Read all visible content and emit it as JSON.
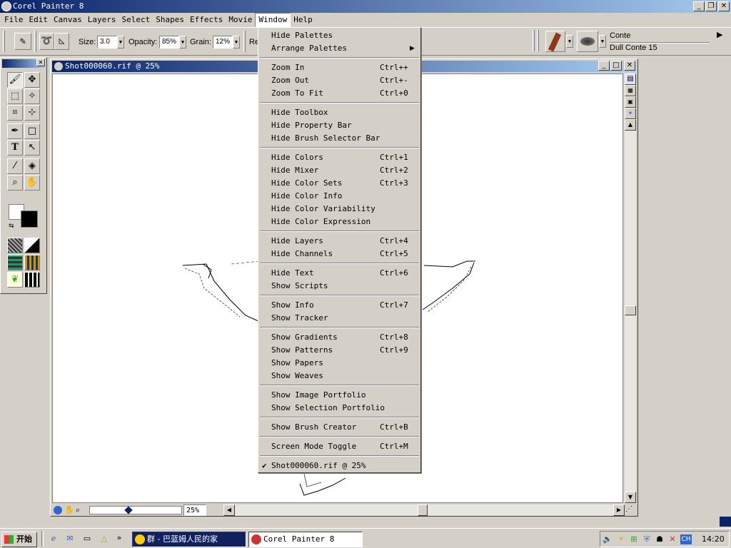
{
  "app": {
    "title": "Corel Painter 8"
  },
  "menubar": [
    {
      "label": "File"
    },
    {
      "label": "Edit"
    },
    {
      "label": "Canvas"
    },
    {
      "label": "Layers"
    },
    {
      "label": "Select"
    },
    {
      "label": "Shapes"
    },
    {
      "label": "Effects"
    },
    {
      "label": "Movie"
    },
    {
      "label": "Window"
    },
    {
      "label": "Help"
    }
  ],
  "propbar": {
    "size_label": "Size:",
    "size_value": "3.0",
    "opacity_label": "Opacity:",
    "opacity_value": "85%",
    "grain_label": "Grain:",
    "grain_value": "12%",
    "extra_label": "Re"
  },
  "brush": {
    "category": "Conte",
    "variant": "Dull Conte 15"
  },
  "document": {
    "title": "Shot000060.rif @ 25%",
    "zoom": "25%"
  },
  "window_menu": {
    "items": [
      {
        "label": "Hide Palettes",
        "shortcut": ""
      },
      {
        "label": "Arrange Palettes",
        "shortcut": "",
        "submenu": true
      },
      {
        "label": "Zoom In",
        "shortcut": "Ctrl++"
      },
      {
        "label": "Zoom Out",
        "shortcut": "Ctrl+-"
      },
      {
        "label": "Zoom To Fit",
        "shortcut": "Ctrl+0"
      },
      {
        "label": "Hide Toolbox",
        "shortcut": ""
      },
      {
        "label": "Hide Property Bar",
        "shortcut": ""
      },
      {
        "label": "Hide Brush Selector Bar",
        "shortcut": ""
      },
      {
        "label": "Hide Colors",
        "shortcut": "Ctrl+1"
      },
      {
        "label": "Hide Mixer",
        "shortcut": "Ctrl+2"
      },
      {
        "label": "Hide Color Sets",
        "shortcut": "Ctrl+3"
      },
      {
        "label": "Hide Color Info",
        "shortcut": ""
      },
      {
        "label": "Hide Color Variability",
        "shortcut": ""
      },
      {
        "label": "Hide Color Expression",
        "shortcut": ""
      },
      {
        "label": "Hide Layers",
        "shortcut": "Ctrl+4"
      },
      {
        "label": "Hide Channels",
        "shortcut": "Ctrl+5"
      },
      {
        "label": "Hide Text",
        "shortcut": "Ctrl+6"
      },
      {
        "label": "Show Scripts",
        "shortcut": ""
      },
      {
        "label": "Show Info",
        "shortcut": "Ctrl+7"
      },
      {
        "label": "Show Tracker",
        "shortcut": ""
      },
      {
        "label": "Show Gradients",
        "shortcut": "Ctrl+8"
      },
      {
        "label": "Show Patterns",
        "shortcut": "Ctrl+9"
      },
      {
        "label": "Show Papers",
        "shortcut": ""
      },
      {
        "label": "Show Weaves",
        "shortcut": ""
      },
      {
        "label": "Show Image Portfolio",
        "shortcut": ""
      },
      {
        "label": "Show Selection Portfolio",
        "shortcut": ""
      },
      {
        "label": "Show Brush Creator",
        "shortcut": "Ctrl+B"
      },
      {
        "label": "Screen Mode Toggle",
        "shortcut": "Ctrl+M"
      },
      {
        "label": "Shot000060.rif @ 25%",
        "shortcut": "",
        "checked": true
      }
    ]
  },
  "taskbar": {
    "start": "开始",
    "tasks": [
      {
        "label": "群 - 巴蓝姆人民的家"
      },
      {
        "label": "Corel Painter 8"
      }
    ],
    "lang": "CH",
    "clock": "14:20"
  },
  "colors": {
    "accent": "#0a246a",
    "face": "#d4d0c8"
  }
}
